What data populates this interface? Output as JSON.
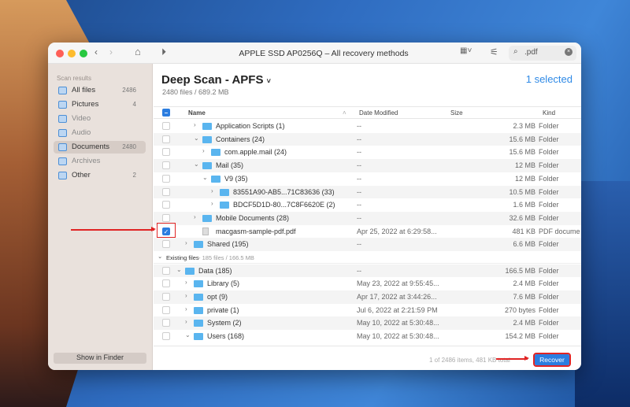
{
  "window": {
    "title": "APPLE SSD AP0256Q – All recovery methods",
    "search_value": ".pdf"
  },
  "sidebar": {
    "heading": "Scan results",
    "items": [
      {
        "label": "All files",
        "count": "2486"
      },
      {
        "label": "Pictures",
        "count": "4"
      },
      {
        "label": "Video",
        "count": ""
      },
      {
        "label": "Audio",
        "count": ""
      },
      {
        "label": "Documents",
        "count": "2480"
      },
      {
        "label": "Archives",
        "count": ""
      },
      {
        "label": "Other",
        "count": "2"
      }
    ],
    "show_in_finder": "Show in Finder"
  },
  "header": {
    "title": "Deep Scan - APFS",
    "subtitle": "2480 files / 689.2 MB",
    "selected": "1 selected"
  },
  "columns": {
    "name": "Name",
    "date": "Date Modified",
    "size": "Size",
    "kind": "Kind"
  },
  "rows": [
    {
      "indent": 3,
      "chev": ">",
      "type": "folder",
      "name": "Application Scripts (1)",
      "date": "--",
      "size": "2.3 MB",
      "kind": "Folder"
    },
    {
      "indent": 3,
      "chev": "v",
      "type": "folder",
      "name": "Containers (24)",
      "date": "--",
      "size": "15.6 MB",
      "kind": "Folder"
    },
    {
      "indent": 4,
      "chev": ">",
      "type": "folder",
      "name": "com.apple.mail (24)",
      "date": "--",
      "size": "15.6 MB",
      "kind": "Folder"
    },
    {
      "indent": 3,
      "chev": "v",
      "type": "folder",
      "name": "Mail (35)",
      "date": "--",
      "size": "12 MB",
      "kind": "Folder"
    },
    {
      "indent": 4,
      "chev": "v",
      "type": "folder",
      "name": "V9 (35)",
      "date": "--",
      "size": "12 MB",
      "kind": "Folder"
    },
    {
      "indent": 5,
      "chev": ">",
      "type": "folder",
      "name": "83551A90-AB5...71C83636 (33)",
      "date": "--",
      "size": "10.5 MB",
      "kind": "Folder"
    },
    {
      "indent": 5,
      "chev": ">",
      "type": "folder",
      "name": "BDCF5D1D-80...7C8F6620E (2)",
      "date": "--",
      "size": "1.6 MB",
      "kind": "Folder"
    },
    {
      "indent": 3,
      "chev": ">",
      "type": "folder",
      "name": "Mobile Documents (28)",
      "date": "--",
      "size": "32.6 MB",
      "kind": "Folder"
    },
    {
      "indent": 3,
      "chev": "",
      "type": "file",
      "name": "macgasm-sample-pdf.pdf",
      "date": "Apr 25, 2022 at 6:29:58...",
      "size": "481 KB",
      "kind": "PDF docume",
      "checked": true
    },
    {
      "indent": 2,
      "chev": ">",
      "type": "folder",
      "name": "Shared (195)",
      "date": "--",
      "size": "6.6 MB",
      "kind": "Folder"
    }
  ],
  "existing_label": "Existing files",
  "existing_meta": " - 185 files / 166.5 MB",
  "existing_rows": [
    {
      "indent": 1,
      "chev": "v",
      "type": "folder",
      "name": "Data (185)",
      "date": "--",
      "size": "166.5 MB",
      "kind": "Folder"
    },
    {
      "indent": 2,
      "chev": ">",
      "type": "folder",
      "name": "Library (5)",
      "date": "May 23, 2022 at 9:55:45...",
      "size": "2.4 MB",
      "kind": "Folder"
    },
    {
      "indent": 2,
      "chev": ">",
      "type": "folder",
      "name": "opt (9)",
      "date": "Apr 17, 2022 at 3:44:26...",
      "size": "7.6 MB",
      "kind": "Folder"
    },
    {
      "indent": 2,
      "chev": ">",
      "type": "folder",
      "name": "private (1)",
      "date": "Jul 6, 2022 at 2:21:59 PM",
      "size": "270 bytes",
      "kind": "Folder"
    },
    {
      "indent": 2,
      "chev": ">",
      "type": "folder",
      "name": "System (2)",
      "date": "May 10, 2022 at 5:30:48...",
      "size": "2.4 MB",
      "kind": "Folder"
    },
    {
      "indent": 2,
      "chev": "v",
      "type": "folder",
      "name": "Users (168)",
      "date": "May 10, 2022 at 5:30:48...",
      "size": "154.2 MB",
      "kind": "Folder"
    }
  ],
  "footer": {
    "status": "1 of 2486 items, 481 KB total",
    "recover": "Recover"
  },
  "colors": {
    "accent": "#2b7de0",
    "annotation": "#e02424"
  }
}
